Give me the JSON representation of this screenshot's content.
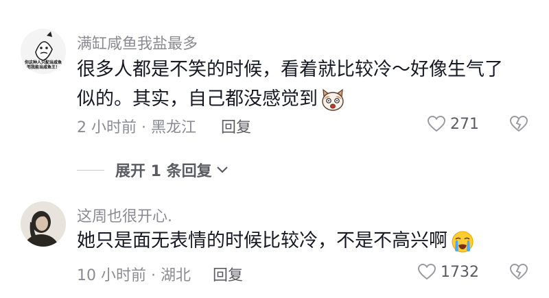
{
  "comments": [
    {
      "username": "满缸咸鱼我盐最多",
      "avatar_caption": [
        "你这种人只配当咸鱼",
        "而我能当咸鱼王！"
      ],
      "text_lines": [
        "很多人都是不笑的时候，看着就比较冷～好像生气了",
        "似的。其实，自己都没感觉到"
      ],
      "emoji": "shocked-cat-emoji",
      "time_location": "2 小时前 · 黑龙江",
      "reply_label": "回复",
      "likes": "271"
    },
    {
      "username": "这周也很开心.",
      "text_lines": [
        "她只是面无表情的时候比较冷，不是不高兴啊"
      ],
      "emoji": "crying-face-emoji",
      "time_location": "10 小时前 · 湖北",
      "reply_label": "回复",
      "likes": "1732"
    }
  ],
  "expand_replies": {
    "label": "展开 1 条回复"
  },
  "colors": {
    "text": "#161823",
    "secondary": "#8a8b91",
    "icon": "#9a9ba1"
  }
}
